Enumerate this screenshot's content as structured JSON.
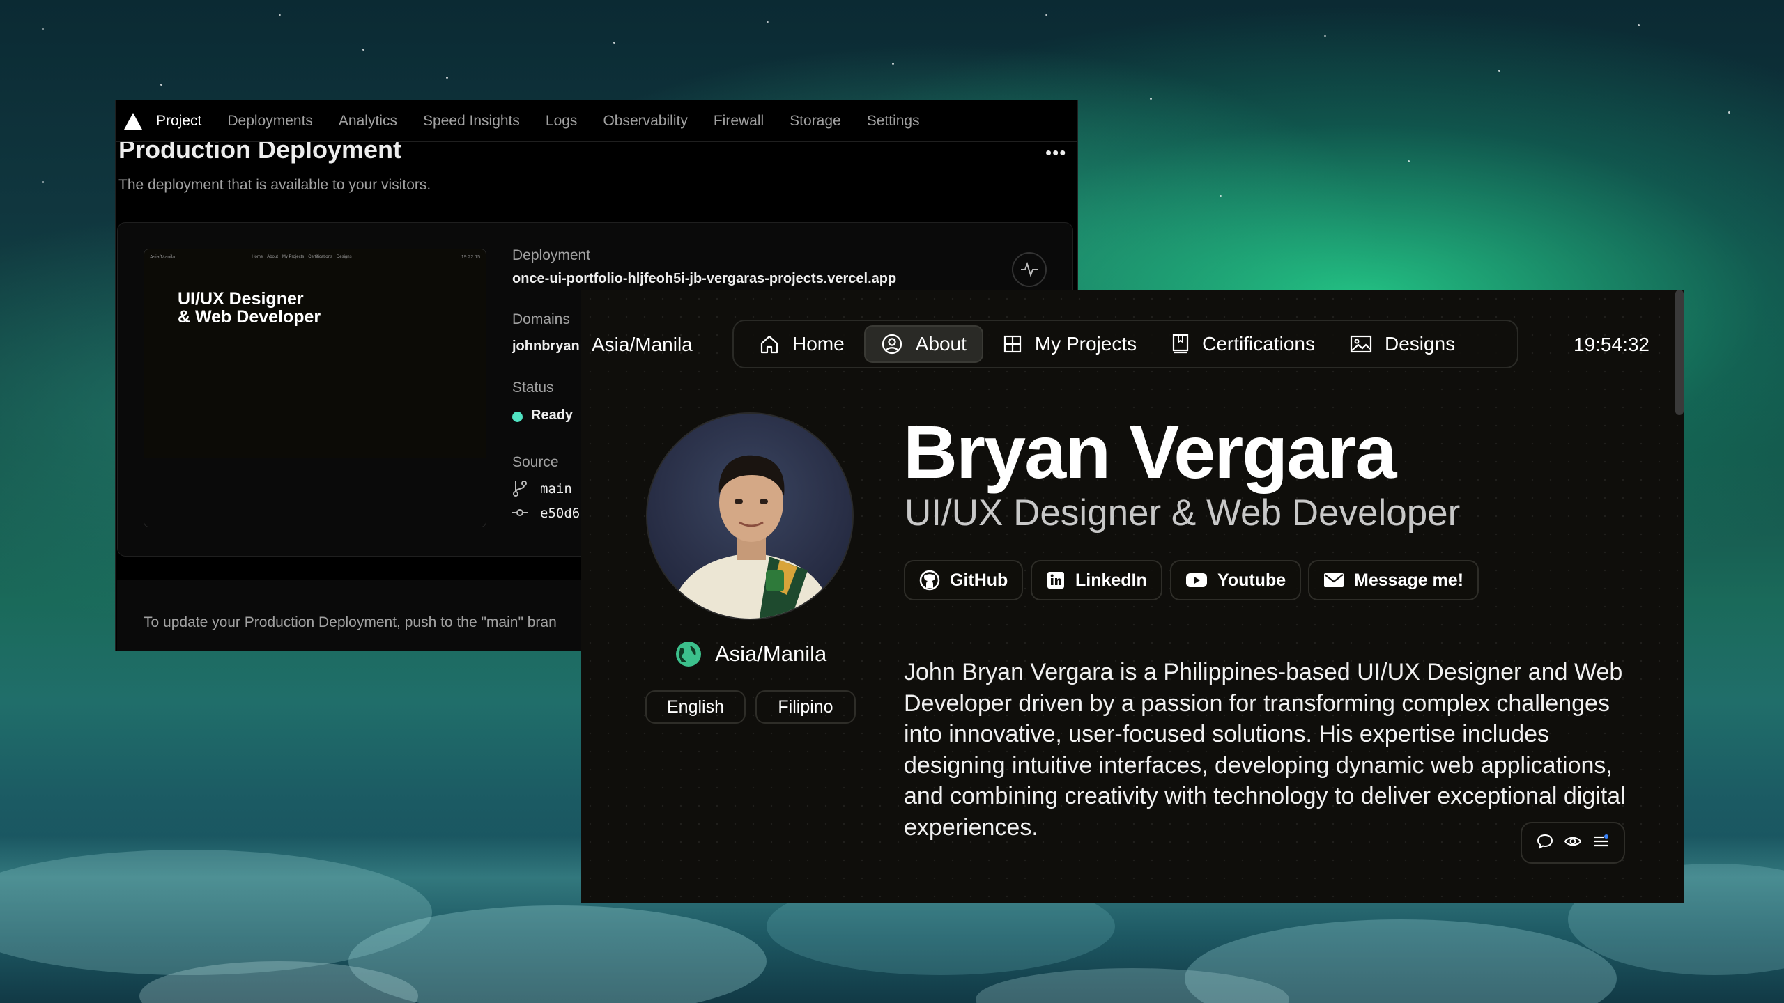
{
  "vercel": {
    "nav": [
      "Project",
      "Deployments",
      "Analytics",
      "Speed Insights",
      "Logs",
      "Observability",
      "Firewall",
      "Storage",
      "Settings"
    ],
    "active_tab": "Project",
    "title": "Production Deployment",
    "subtitle": "The deployment that is available to your visitors.",
    "more_label": "•••",
    "thumbnail": {
      "timezone": "Asia/Manila",
      "nav": [
        "Home",
        "About",
        "My Projects",
        "Certifications",
        "Designs"
      ],
      "clock": "19:22:15",
      "title_line1": "UI/UX Designer",
      "title_line2": "& Web Developer"
    },
    "deployment_label": "Deployment",
    "deployment_url": "once-ui-portfolio-hljfeoh5i-jb-vergaras-projects.vercel.app",
    "domains_label": "Domains",
    "domain_value": "johnbryan",
    "status_label": "Status",
    "status_value": "Ready",
    "status_color": "#50e3c2",
    "source_label": "Source",
    "branch": "main",
    "commit": "e50d6",
    "footer": "To update your Production Deployment, push to the \"main\" bran"
  },
  "portfolio": {
    "timezone": "Asia/Manila",
    "nav": [
      {
        "label": "Home",
        "icon": "home-icon"
      },
      {
        "label": "About",
        "icon": "user-circle-icon"
      },
      {
        "label": "My Projects",
        "icon": "grid-icon"
      },
      {
        "label": "Certifications",
        "icon": "book-icon"
      },
      {
        "label": "Designs",
        "icon": "image-icon"
      }
    ],
    "active_nav": "About",
    "clock": "19:54:32",
    "name": "Bryan Vergara",
    "role": "UI/UX Designer & Web Developer",
    "location": "Asia/Manila",
    "languages": [
      "English",
      "Filipino"
    ],
    "links": [
      {
        "label": "GitHub",
        "icon": "github-icon"
      },
      {
        "label": "LinkedIn",
        "icon": "linkedin-icon"
      },
      {
        "label": "Youtube",
        "icon": "youtube-icon"
      },
      {
        "label": "Message me!",
        "icon": "mail-icon"
      }
    ],
    "bio": "John Bryan Vergara is a Philippines-based UI/UX Designer and Web Developer driven by a passion for transforming complex challenges into innovative, user-focused solutions. His expertise includes designing intuitive interfaces, developing dynamic web applications, and combining creativity with technology to deliver exceptional digital experiences.",
    "accent_green": "#3cc08c"
  }
}
